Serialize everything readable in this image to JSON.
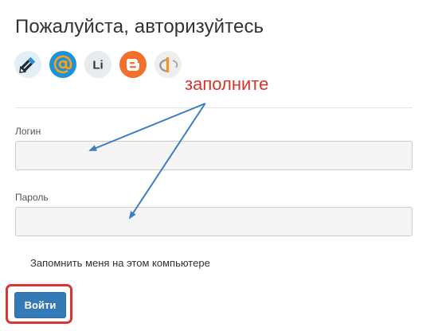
{
  "header": {
    "title": "Пожалуйста, авторизуйтесь"
  },
  "providers": [
    {
      "icon": "livejournal-icon",
      "color": "#e3eef5"
    },
    {
      "icon": "mail-at-icon",
      "color": "#1f91d6"
    },
    {
      "icon": "liveinternet-icon",
      "label": "Li",
      "color": "#e8ecef"
    },
    {
      "icon": "blogger-icon",
      "color": "#f2702b"
    },
    {
      "icon": "openid-icon",
      "color": "#eeeeee"
    }
  ],
  "form": {
    "login_label": "Логин",
    "login_value": "",
    "password_label": "Пароль",
    "password_value": "",
    "remember_label": "Запомнить меня на этом компьютере",
    "submit_label": "Войти"
  },
  "annotation": {
    "text": "заполните",
    "color": "#d9342b",
    "arrow_color": "#3d7ec2",
    "highlight_color": "#d93535"
  }
}
